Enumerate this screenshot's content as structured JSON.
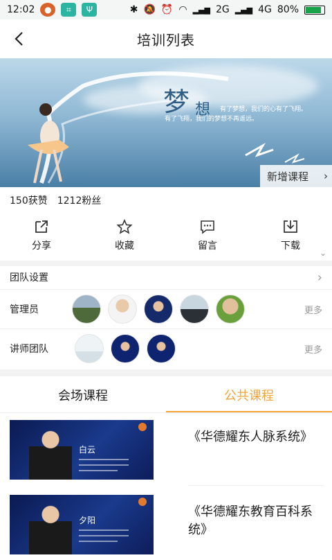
{
  "status_bar": {
    "time": "12:02",
    "network": "2G",
    "network2": "4G",
    "battery": "80%",
    "battery_level": 0.8
  },
  "header": {
    "back_icon": "chevron-left-icon",
    "title": "培训列表"
  },
  "banner": {
    "big_char": "梦",
    "small_char": "想",
    "tagline1": "有了梦想，我们的心有了飞翔。",
    "tagline2": "有了飞翔，我们的梦想不再遥远。",
    "add_course_label": "新增课程"
  },
  "stats": {
    "likes": "150获赞",
    "fans": "1212粉丝"
  },
  "actions": [
    {
      "label": "分享",
      "icon": "share-icon"
    },
    {
      "label": "收藏",
      "icon": "star-icon"
    },
    {
      "label": "留言",
      "icon": "comment-icon"
    },
    {
      "label": "下载",
      "icon": "download-icon"
    }
  ],
  "team": {
    "settings_label": "团队设置",
    "admins_label": "管理员",
    "admins_more": "更多",
    "lecturers_label": "讲师团队",
    "lecturers_more": "更多"
  },
  "tabs": [
    {
      "label": "会场课程",
      "active": false
    },
    {
      "label": "公共课程",
      "active": true
    }
  ],
  "courses": [
    {
      "title": "《华德耀东人脉系统》",
      "speaker": "白云"
    },
    {
      "title": "《华德耀东教育百科系统》",
      "speaker": "夕阳"
    }
  ],
  "colors": {
    "accent": "#f3a53a",
    "battery": "#17a34a"
  }
}
